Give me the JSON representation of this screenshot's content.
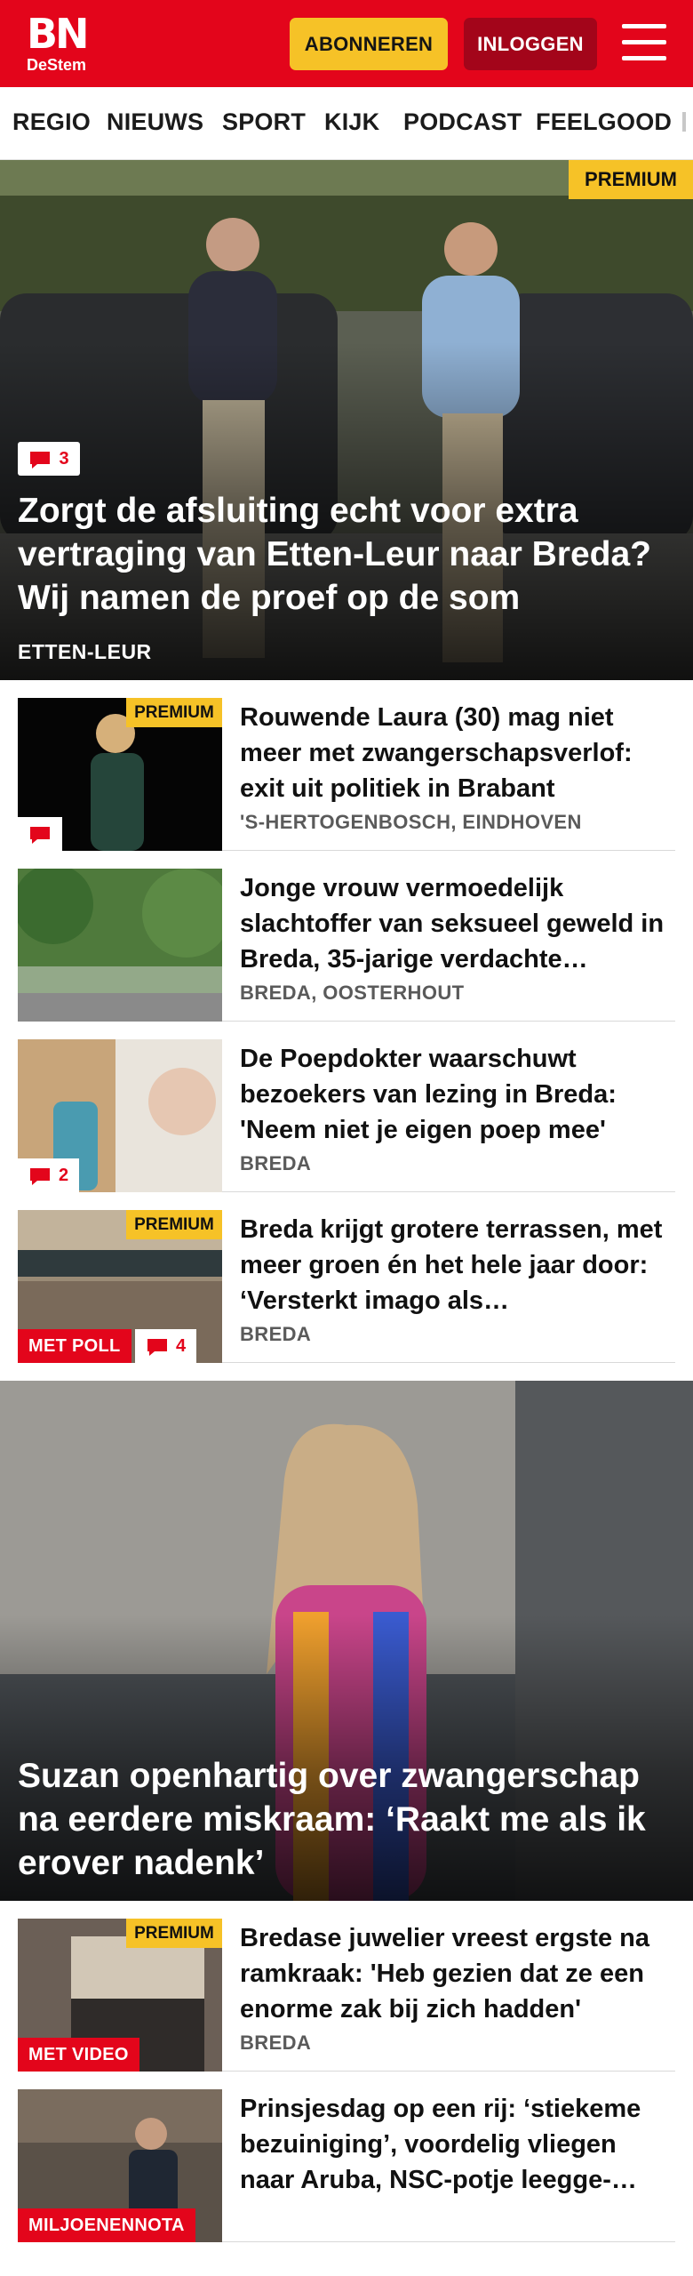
{
  "header": {
    "logo_main": "BN",
    "logo_sub": "DeStem",
    "subscribe_label": "ABONNEREN",
    "login_label": "INLOGGEN",
    "menu_icon": "hamburger-menu-icon",
    "brand_red": "#e3051b",
    "accent_yellow": "#f6c227"
  },
  "nav": {
    "items": [
      "REGIO",
      "NIEUWS",
      "SPORT",
      "KIJK",
      "PODCAST",
      "FEELGOOD"
    ]
  },
  "hero": {
    "premium_label": "PREMIUM",
    "comment_count": "3",
    "title": "Zorgt de afsluiting echt voor extra vertraging van Etten-Leur naar Breda? Wij namen de proef op de som",
    "location": "ETTEN-LEUR"
  },
  "articles": [
    {
      "title": "Rouwende Laura (30) mag niet meer met zwangerschapsverlof: exit uit politiek in Brabant",
      "location": "'S-HERTOGENBOSCH, EINDHOVEN",
      "premium_label": "PREMIUM",
      "comment_count": ""
    },
    {
      "title": "Jonge vrouw vermoedelijk slachtoffer van seksueel geweld in Breda, 35-jarige verdachte…",
      "location": "BREDA, OOSTERHOUT"
    },
    {
      "title": "De Poepdokter waarschuwt bezoekers van lezing in Breda: 'Neem niet je eigen poep mee'",
      "location": "BREDA",
      "comment_count": "2"
    },
    {
      "title": "Breda krijgt grotere terrassen, met meer groen én het hele jaar door: ‘Versterkt imago als…",
      "location": "BREDA",
      "premium_label": "PREMIUM",
      "badge": "MET POLL",
      "comment_count": "4"
    }
  ],
  "feature": {
    "title": "Suzan openhartig over zwangerschap na eerdere miskraam: ‘Raakt me als ik erover nadenk’"
  },
  "articles_bottom": [
    {
      "title": "Bredase juwelier vreest ergste na ramkraak: 'Heb gezien dat ze een enorme zak bij zich hadden'",
      "location": "BREDA",
      "premium_label": "PREMIUM",
      "badge": "MET VIDEO"
    },
    {
      "title": "Prinsjesdag op een rij: ‘stiekeme bezuiniging’, voordelig vliegen naar Aruba, NSC-potje leegge-…",
      "badge": "MILJOENENNOTA"
    }
  ],
  "icons": {
    "comment": "comment-bubble-icon"
  }
}
